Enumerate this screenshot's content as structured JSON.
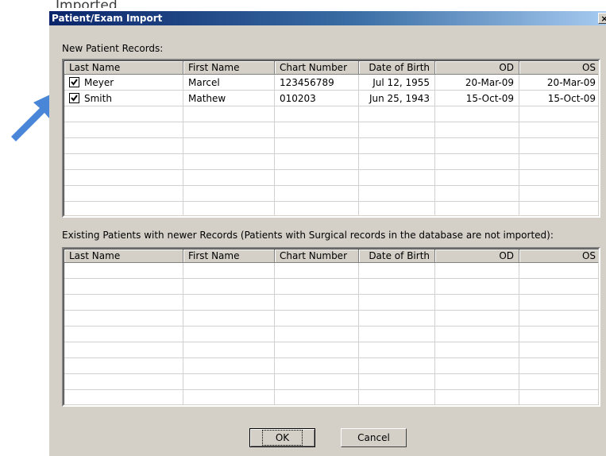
{
  "background_text": "Imported",
  "window": {
    "title": "Patient/Exam Import",
    "close_label": "×"
  },
  "new_section": {
    "label": "New Patient Records:",
    "columns": [
      "Last Name",
      "First Name",
      "Chart Number",
      "Date of Birth",
      "OD",
      "OS"
    ],
    "rows": [
      {
        "checked": true,
        "last": "Meyer",
        "first": "Marcel",
        "chart": "123456789",
        "dob": "Jul 12, 1955",
        "od": "20-Mar-09",
        "os": "20-Mar-09"
      },
      {
        "checked": true,
        "last": "Smith",
        "first": "Mathew",
        "chart": "010203",
        "dob": "Jun 25, 1943",
        "od": "15-Oct-09",
        "os": "15-Oct-09"
      }
    ]
  },
  "existing_section": {
    "label": "Existing Patients with newer Records (Patients with Surgical records in the database are not imported):",
    "columns": [
      "Last Name",
      "First Name",
      "Chart Number",
      "Date of Birth",
      "OD",
      "OS"
    ]
  },
  "buttons": {
    "ok": "OK",
    "cancel": "Cancel"
  },
  "colors": {
    "arrow": "#4a86d8",
    "title_start": "#0a246a",
    "title_end": "#a6caf0"
  }
}
